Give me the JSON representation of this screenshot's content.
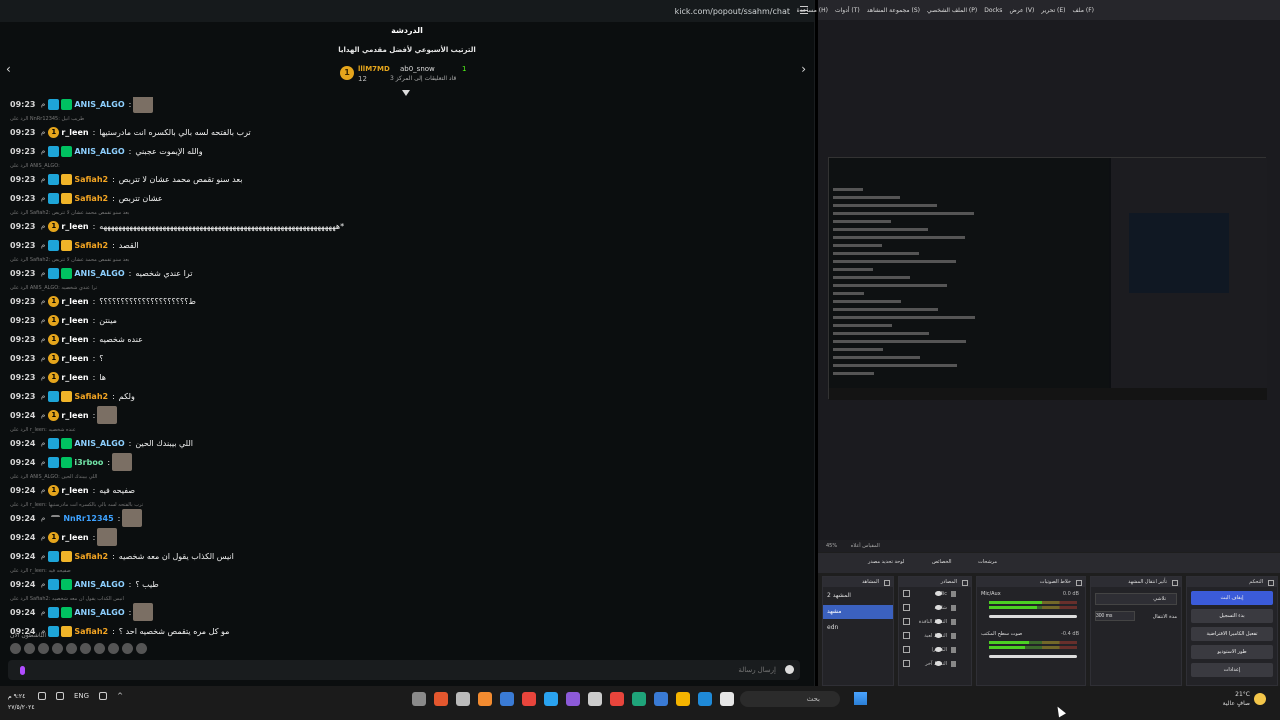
{
  "chat": {
    "url": "kick.com/popout/ssahm/chat",
    "title": "الدردشة",
    "leaderboard": {
      "subtitle": "الترتيب الأسبوعي لأفضل مقدمي الهدايا",
      "entries": [
        {
          "rank": "1",
          "name": "lllM7MD",
          "count": "12"
        },
        {
          "name": "ab0_snow",
          "count": "1",
          "desc": "قاد التعليقات إلى المركز 3"
        }
      ]
    },
    "messages": [
      {
        "time": "09:23",
        "ampm": "م",
        "user": "ANIS_ALGO",
        "cls": "u-anis",
        "badges": [
          "mod",
          "sub"
        ],
        "text": "",
        "avatar": true
      },
      {
        "reply": "الرد على NnRr12345: طريب انيل"
      },
      {
        "time": "09:23",
        "ampm": "م",
        "user": "r_leen",
        "cls": "u-leen",
        "badges": [
          "og"
        ],
        "text": "ترب بالفتحه لسه بالي بالكسره انت مادرستيها"
      },
      {
        "time": "09:23",
        "ampm": "م",
        "user": "ANIS_ALGO",
        "cls": "u-anis",
        "badges": [
          "mod",
          "sub"
        ],
        "text": "والله الإيموت عجبني"
      },
      {
        "reply": "الرد على ANIS_ALGO:"
      },
      {
        "time": "09:23",
        "ampm": "م",
        "user": "Safiah2",
        "cls": "u-saf",
        "badges": [
          "mod",
          "vip"
        ],
        "text": "بعد سنو تقمص محمد عشان لا تتربص"
      },
      {
        "time": "09:23",
        "ampm": "م",
        "user": "Safiah2",
        "cls": "u-saf",
        "badges": [
          "mod",
          "vip"
        ],
        "text": "عشان تتربص"
      },
      {
        "reply": "الرد على Safiah2: بعد سنو تقمص محمد عشان لا تتربص"
      },
      {
        "time": "09:23",
        "ampm": "م",
        "user": "r_leen",
        "cls": "u-leen",
        "badges": [
          "og"
        ],
        "text": "ههههههههههههههههههههههههههههههههههههههههههههههههههههههههههههههههه*"
      },
      {
        "time": "09:23",
        "ampm": "م",
        "user": "Safiah2",
        "cls": "u-saf",
        "badges": [
          "mod",
          "vip"
        ],
        "text": "القصد"
      },
      {
        "reply": "الرد على Safiah2: بعد سنو تقمص محمد عشان لا تتربص"
      },
      {
        "time": "09:23",
        "ampm": "م",
        "user": "ANIS_ALGO",
        "cls": "u-anis",
        "badges": [
          "mod",
          "sub"
        ],
        "text": "ترا عندي شخصيه"
      },
      {
        "reply": "الرد على ANIS_ALGO: ترا عندي شخصيه"
      },
      {
        "time": "09:23",
        "ampm": "م",
        "user": "r_leen",
        "cls": "u-leen",
        "badges": [
          "og"
        ],
        "text": "ط؟؟؟؟؟؟؟؟؟؟؟؟؟؟؟؟؟؟؟؟؟"
      },
      {
        "time": "09:23",
        "ampm": "م",
        "user": "r_leen",
        "cls": "u-leen",
        "badges": [
          "og"
        ],
        "text": "مينتن"
      },
      {
        "time": "09:23",
        "ampm": "م",
        "user": "r_leen",
        "cls": "u-leen",
        "badges": [
          "og"
        ],
        "text": "عنده شخصيه"
      },
      {
        "time": "09:23",
        "ampm": "م",
        "user": "r_leen",
        "cls": "u-leen",
        "badges": [
          "og"
        ],
        "text": "؟"
      },
      {
        "time": "09:23",
        "ampm": "م",
        "user": "r_leen",
        "cls": "u-leen",
        "badges": [
          "og"
        ],
        "text": "ها"
      },
      {
        "time": "09:23",
        "ampm": "م",
        "user": "Safiah2",
        "cls": "u-saf",
        "badges": [
          "mod",
          "vip"
        ],
        "text": "ولكم"
      },
      {
        "time": "09:24",
        "ampm": "م",
        "user": "r_leen",
        "cls": "u-leen",
        "badges": [
          "og"
        ],
        "text": "",
        "avatar": true
      },
      {
        "reply": "الرد على r_leen: عنده شخصيه"
      },
      {
        "time": "09:24",
        "ampm": "م",
        "user": "ANIS_ALGO",
        "cls": "u-anis",
        "badges": [
          "mod",
          "sub"
        ],
        "text": "اللي بيبندك الحين"
      },
      {
        "time": "09:24",
        "ampm": "م",
        "user": "i3rboo",
        "cls": "u-i3",
        "badges": [
          "mod",
          "sub"
        ],
        "text": "",
        "avatar": true
      },
      {
        "reply": "الرد على ANIS_ALGO: اللي بيبندك الحين"
      },
      {
        "time": "09:24",
        "ampm": "م",
        "user": "r_leen",
        "cls": "u-leen",
        "badges": [
          "og"
        ],
        "text": "صفيحه فيه"
      },
      {
        "reply": "الرد على r_leen: ترب بالفتحه لسه بالي بالكسره انت مادرستيها"
      },
      {
        "time": "09:24",
        "ampm": "م",
        "user": "NnRr12345",
        "cls": "u-nn",
        "badges": [
          "hat"
        ],
        "text": "",
        "avatar": true
      },
      {
        "time": "09:24",
        "ampm": "م",
        "user": "r_leen",
        "cls": "u-leen",
        "badges": [
          "og"
        ],
        "text": "",
        "avatar": true
      },
      {
        "time": "09:24",
        "ampm": "م",
        "user": "Safiah2",
        "cls": "u-saf",
        "badges": [
          "mod",
          "vip"
        ],
        "text": "انيس الكذاب يقول ان معه شخصيه"
      },
      {
        "reply": "الرد على r_leen: صفيحه فيه"
      },
      {
        "time": "09:24",
        "ampm": "م",
        "user": "ANIS_ALGO",
        "cls": "u-anis",
        "badges": [
          "mod",
          "sub"
        ],
        "text": "طيب ؟"
      },
      {
        "reply": "الرد على Safiah2: انيس الكذاب يقول ان معه شخصيه"
      },
      {
        "time": "09:24",
        "ampm": "م",
        "user": "ANIS_ALGO",
        "cls": "u-anis",
        "badges": [
          "mod",
          "sub"
        ],
        "text": "",
        "avatar": true
      },
      {
        "time": "09:24",
        "ampm": "م",
        "user": "Safiah2",
        "cls": "u-saf",
        "badges": [
          "mod",
          "vip"
        ],
        "text": "مو كل مره يتقمص شخصيه احد ؟"
      }
    ],
    "active_label": "الناشطون الآن",
    "input_placeholder": "إرسال رسالة"
  },
  "obs": {
    "menu": [
      "ملف (F)",
      "تحرير (E)",
      "عرض (V)",
      "Docks",
      "الملف الشخصي (P)",
      "مجموعة المشاهد (S)",
      "أدوات (T)",
      "مساعدة (H)"
    ],
    "statusbar": [
      "45%",
      "المقياس أعلاه"
    ],
    "scene_tools": [
      "الخصائص",
      "مرشحات",
      "لوحة تحديد مصدر"
    ],
    "docks": {
      "scenes_title": "المشاهد",
      "scenes": [
        "المشهد 2",
        "مشهد",
        "edn"
      ],
      "active_scene_index": 1,
      "sources_title": "المصادر",
      "sources": [
        "Mic",
        "شاشة",
        "التقاط النافذة",
        "التقاط لعبة",
        "الكاميرا",
        "التقاط آخر"
      ],
      "mixer_title": "خلاط الصوتيات",
      "mixer": [
        {
          "name": "Mic/Aux",
          "db": "0.0 dB",
          "level": 0.6
        },
        {
          "name": "صوت سطح المكتب",
          "db": "-0.4 dB",
          "level": 0.45
        }
      ],
      "transitions_title": "تأثير انتقال المشهد",
      "transition_type": "تلاشي",
      "duration_label": "مدة الانتقال",
      "duration_value": "300 ms",
      "controls_title": "التحكم",
      "controls": [
        "إيقاف البث",
        "بدء التسجيل",
        "تفعيل الكاميرا الافتراضية",
        "طور الاستوديو",
        "إعدادات"
      ]
    }
  },
  "taskbar": {
    "clock_time": "٩:٢٤ م",
    "clock_date": "٢٧/٥/٢٠٢٤",
    "lang": "ENG",
    "search": "بحث",
    "weather_temp": "21°C",
    "weather_desc": "صافٍ عالية"
  },
  "colors": {
    "kick_green": "#53fc18",
    "obs_accent": "#3b5bd9"
  }
}
